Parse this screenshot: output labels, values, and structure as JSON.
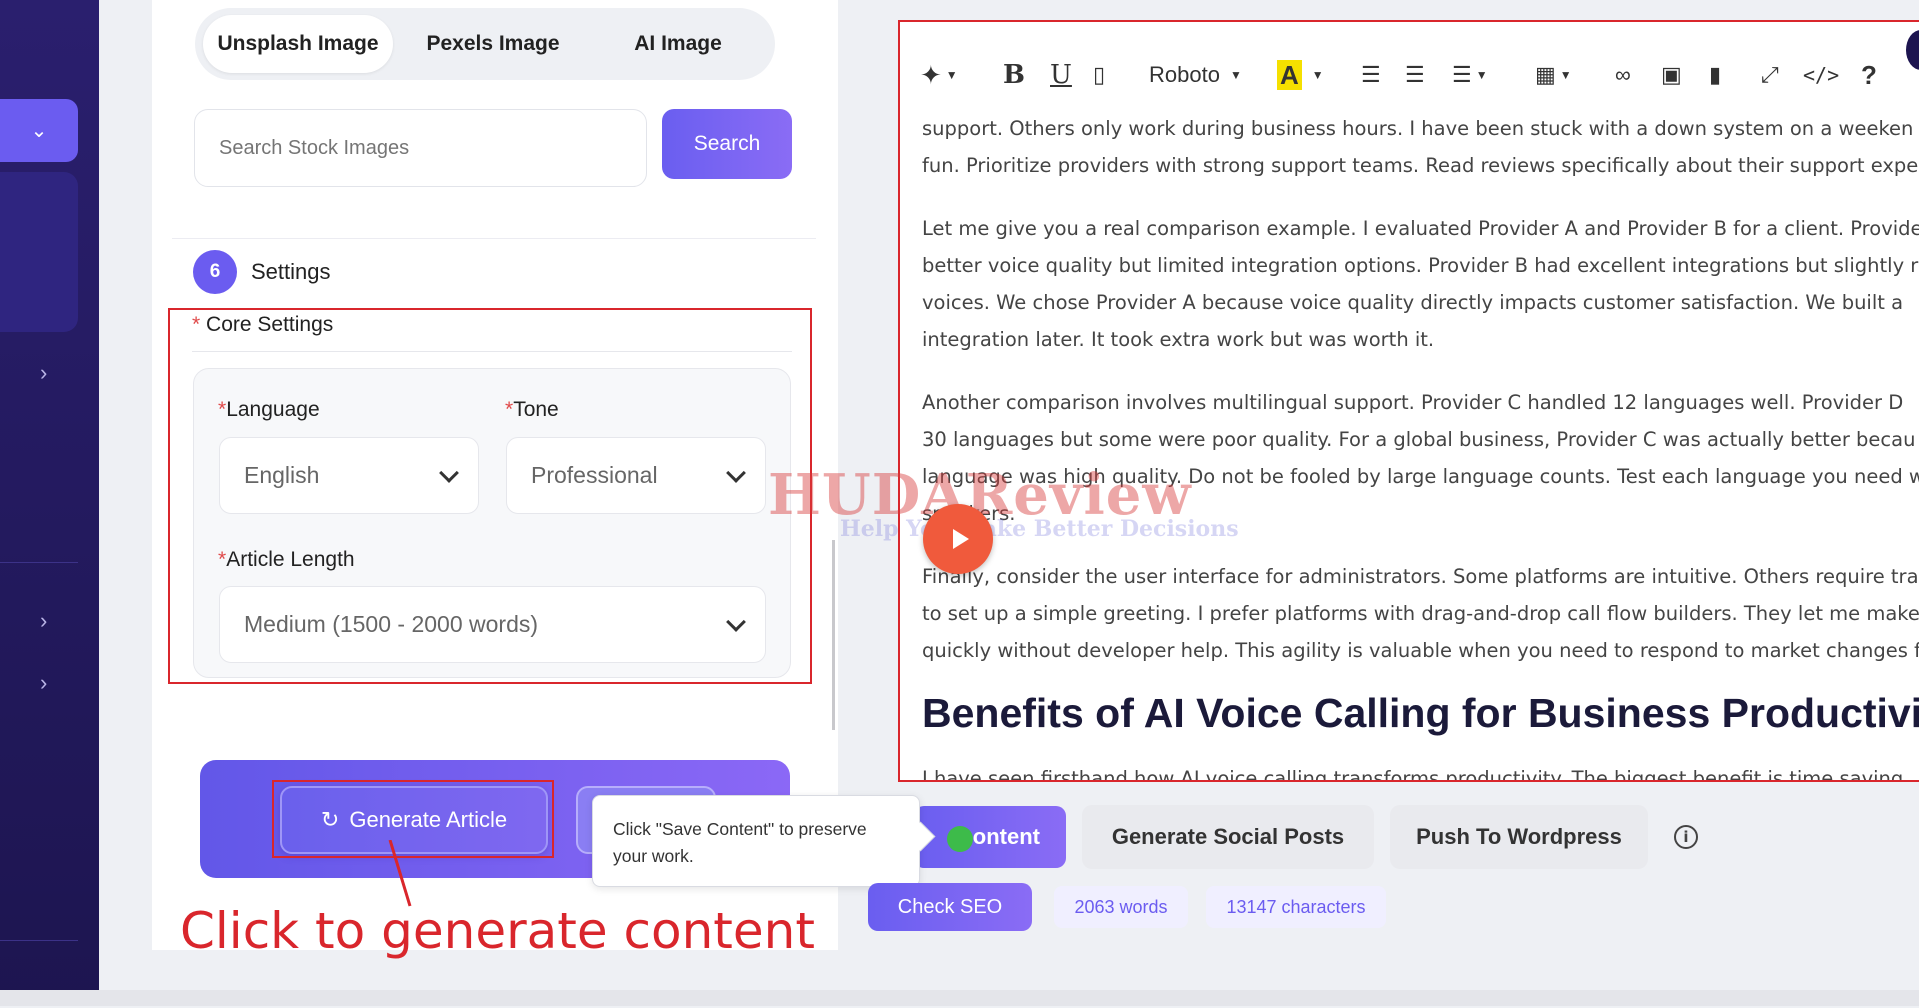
{
  "image_tabs": [
    "Unsplash Image",
    "Pexels Image",
    "AI Image"
  ],
  "search": {
    "placeholder": "Search Stock Images",
    "button": "Search"
  },
  "step": {
    "number": "6",
    "label": "Settings"
  },
  "core_settings": {
    "required_mark": "*",
    "title": "Core Settings",
    "language": {
      "label": "Language",
      "value": "English"
    },
    "tone": {
      "label": "Tone",
      "value": "Professional"
    },
    "article_length": {
      "label": "Article Length",
      "value": "Medium (1500 - 2000 words)"
    }
  },
  "generate_button": "Generate Article",
  "annotation": "Click to generate content",
  "tooltip": "Click \"Save Content\" to preserve your work.",
  "toolbar": {
    "font": "Roboto"
  },
  "editor": {
    "lines": [
      "support. Others only work during business hours. I have been stuck with a down system on a weeken",
      "fun. Prioritize providers with strong support teams. Read reviews specifically about their support expe",
      "Let me give you a real comparison example. I evaluated Provider A and Provider B for a client. Provide",
      "better voice quality but limited integration options. Provider B had excellent integrations but slightly ro",
      "voices. We chose Provider A because voice quality directly impacts customer satisfaction. We built a",
      "integration later. It took extra work but was worth it.",
      "Another comparison involves multilingual support. Provider C handled 12 languages well. Provider D",
      "30 languages but some were poor quality. For a global business, Provider C was actually better becau",
      "language was high quality. Do not be fooled by large language counts. Test each language you need w",
      "speakers.",
      "Finally, consider the user interface for administrators. Some platforms are intuitive. Others require tra",
      "to set up a simple greeting. I prefer platforms with drag-and-drop call flow builders. They let me make",
      "quickly without developer help. This agility is valuable when you need to respond to market changes f"
    ],
    "heading": "Benefits of AI Voice Calling for Business Productivi",
    "partial_line": "I have seen firsthand how AI voice calling transforms productivity. The biggest benefit is time saving"
  },
  "watermark": {
    "brand": "HUDAReview",
    "tagline": "Help You Make Better Decisions"
  },
  "actions": {
    "save": "Save Content",
    "save_visible": "ontent",
    "social": "Generate Social Posts",
    "wordpress": "Push To Wordpress",
    "seo": "Check SEO"
  },
  "stats": {
    "words": "2063 words",
    "characters": "13147 characters"
  }
}
